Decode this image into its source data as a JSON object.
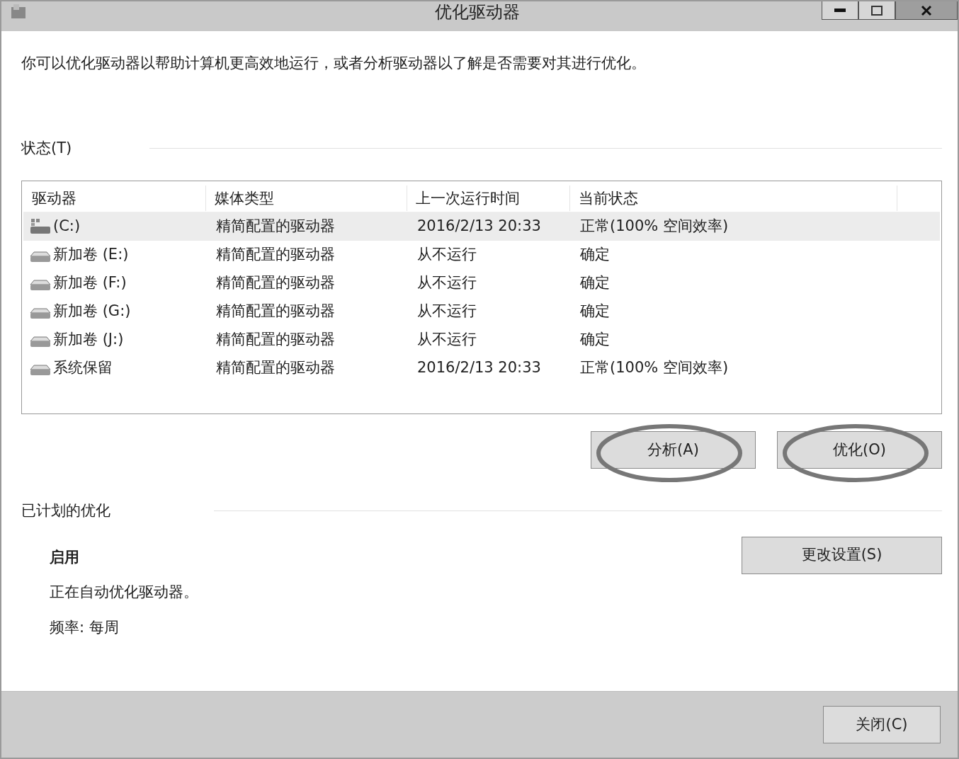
{
  "window": {
    "title": "优化驱动器"
  },
  "description": "你可以优化驱动器以帮助计算机更高效地运行，或者分析驱动器以了解是否需要对其进行优化。",
  "status_section": {
    "title": "状态(T)"
  },
  "table": {
    "columns": [
      "驱动器",
      "媒体类型",
      "上一次运行时间",
      "当前状态"
    ],
    "rows": [
      {
        "kind": "system",
        "selected": true,
        "cells": [
          "(C:)",
          "精简配置的驱动器",
          "2016/2/13 20:33",
          "正常(100% 空间效率)"
        ]
      },
      {
        "kind": "volume",
        "selected": false,
        "cells": [
          "新加卷 (E:)",
          "精简配置的驱动器",
          "从不运行",
          "确定"
        ]
      },
      {
        "kind": "volume",
        "selected": false,
        "cells": [
          "新加卷 (F:)",
          "精简配置的驱动器",
          "从不运行",
          "确定"
        ]
      },
      {
        "kind": "volume",
        "selected": false,
        "cells": [
          "新加卷 (G:)",
          "精简配置的驱动器",
          "从不运行",
          "确定"
        ]
      },
      {
        "kind": "volume",
        "selected": false,
        "cells": [
          "新加卷 (J:)",
          "精简配置的驱动器",
          "从不运行",
          "确定"
        ]
      },
      {
        "kind": "volume",
        "selected": false,
        "cells": [
          "系统保留",
          "精简配置的驱动器",
          "2016/2/13 20:33",
          "正常(100% 空间效率)"
        ]
      }
    ]
  },
  "actions": [
    {
      "label": "分析(A)",
      "highlighted": true
    },
    {
      "label": "优化(O)",
      "highlighted": true
    }
  ],
  "scheduled": {
    "title": "已计划的优化",
    "state": "启用",
    "detail": "正在自动优化驱动器。",
    "frequency": "频率: 每周",
    "button": "更改设置(S)"
  },
  "footer": {
    "button": "关闭(C)"
  }
}
